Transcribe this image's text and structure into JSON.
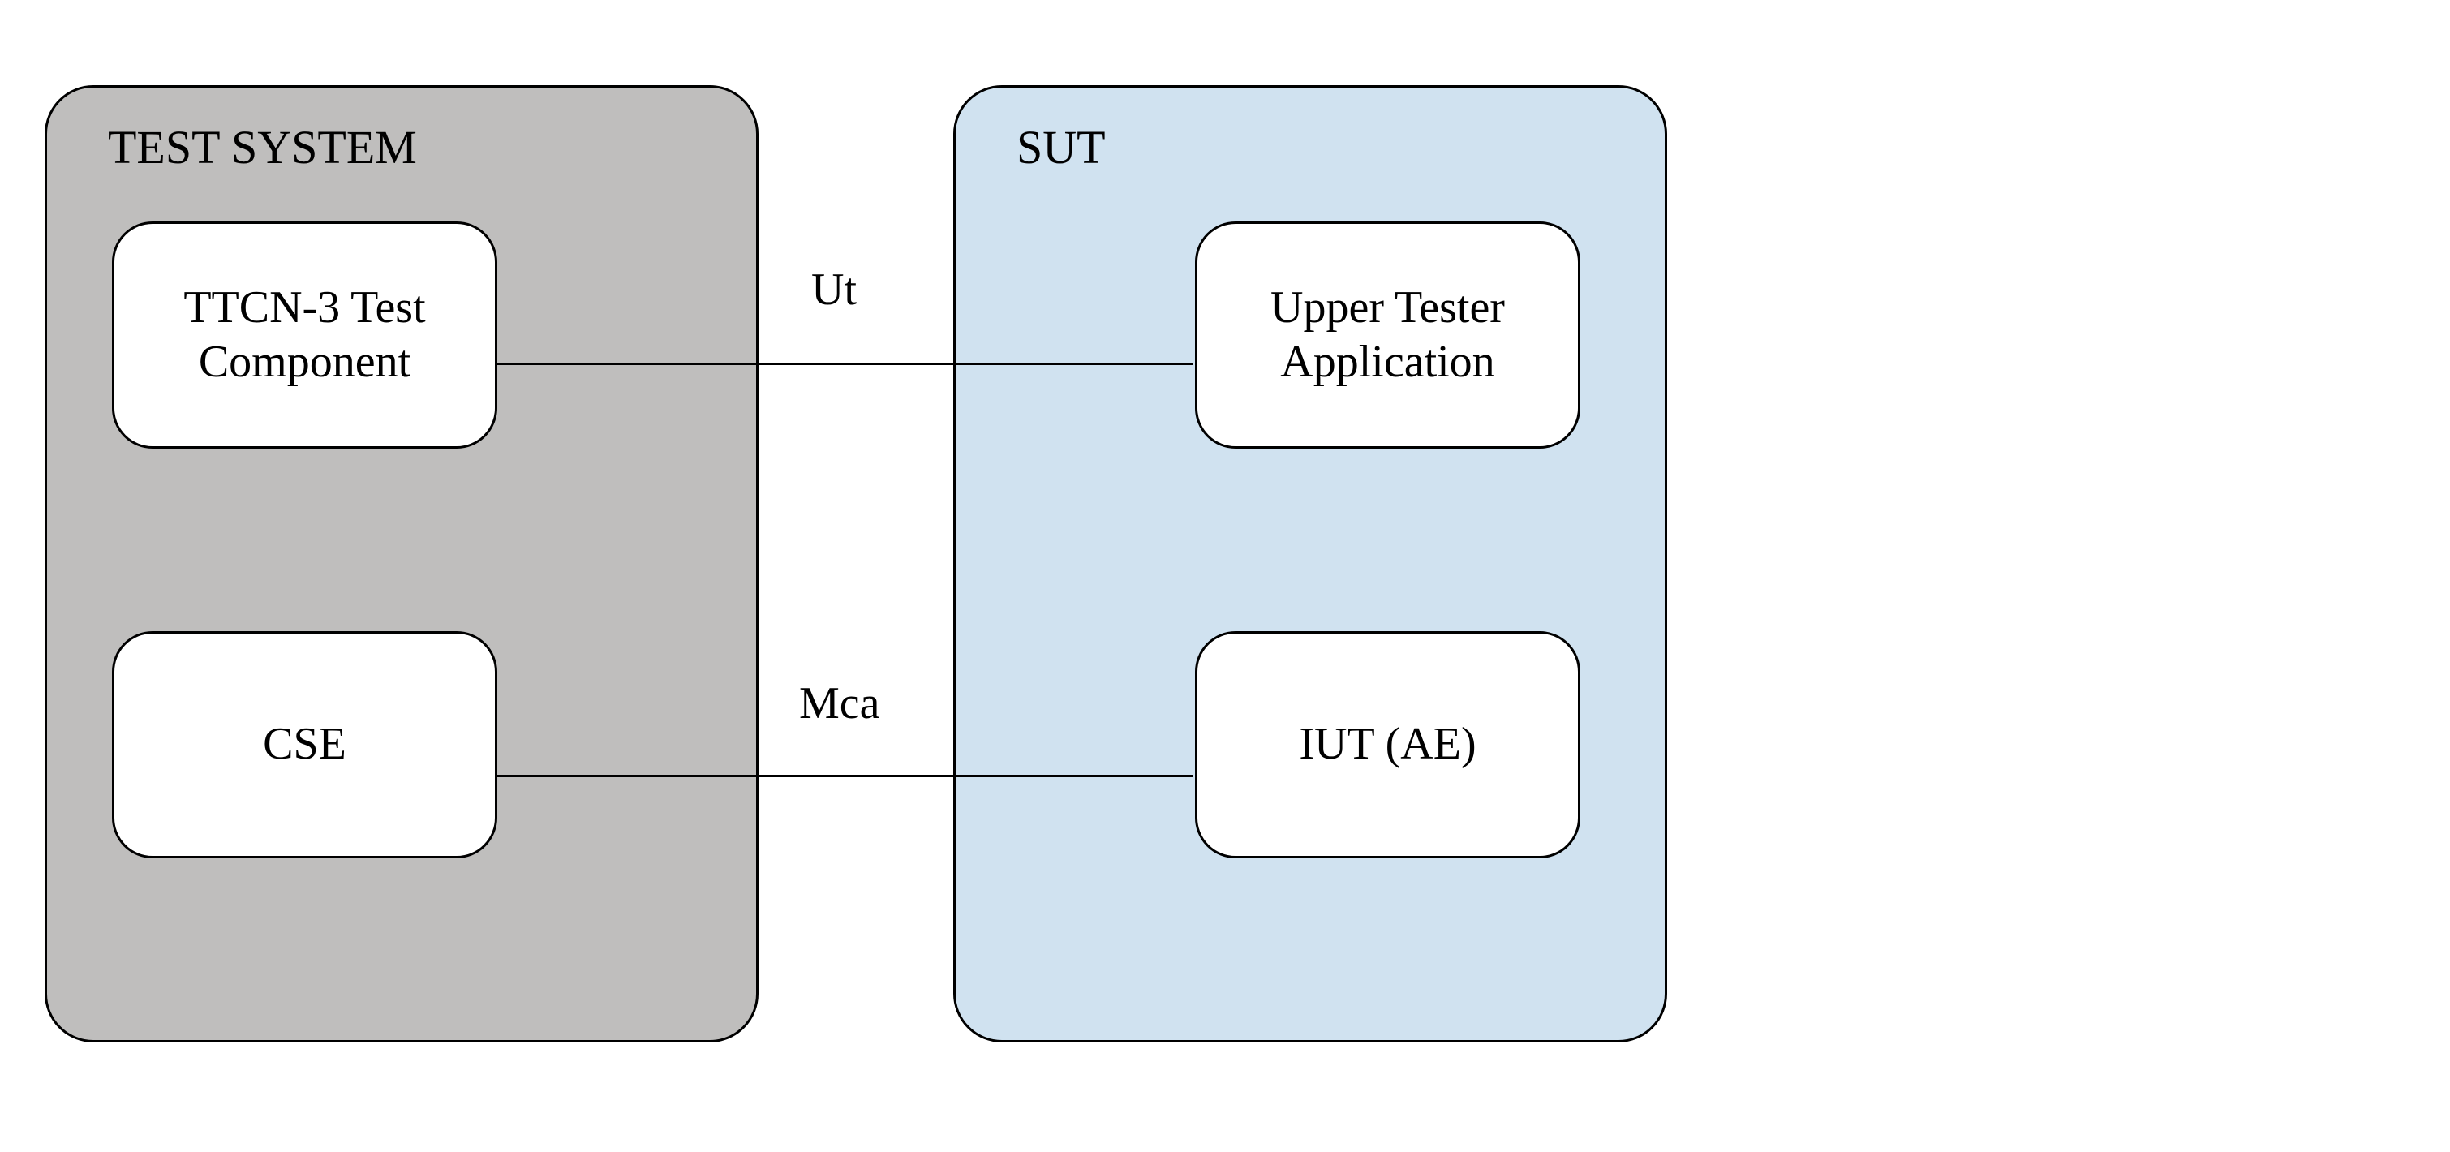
{
  "blocks": {
    "test_system": {
      "title": "TEST SYSTEM",
      "top_box": "TTCN-3 Test\nComponent",
      "bottom_box": "CSE"
    },
    "sut": {
      "title": "SUT",
      "top_box": "Upper Tester\nApplication",
      "bottom_box": "IUT (AE)"
    }
  },
  "connectors": {
    "top": "Ut",
    "bottom": "Mca"
  }
}
